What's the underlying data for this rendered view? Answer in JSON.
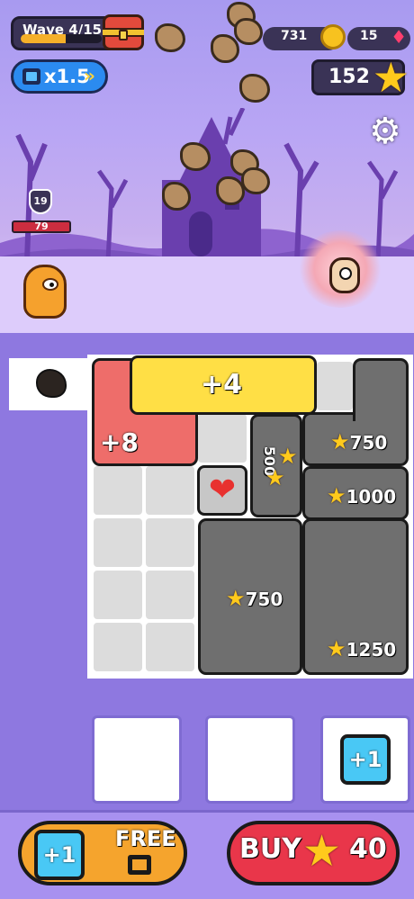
{
  "hud": {
    "wave_label": "Wave 4/15",
    "wave_progress": 0.55,
    "coins": "731",
    "gems": "15",
    "speed": "x1.5",
    "stars": "152"
  },
  "enemy": {
    "level": "19",
    "hp": "79"
  },
  "board": {
    "next_piece": "rock",
    "blocks": {
      "plus4": "+4",
      "plus8": "+8",
      "b750_top": "750",
      "b_vertical": "500",
      "b1000": "1000",
      "b750_big": "750",
      "b1250": "1250"
    }
  },
  "slots": {
    "plus1": "+1"
  },
  "footer": {
    "free_plus": "+1",
    "free_label": "FREE",
    "buy_label": "BUY",
    "buy_price": "40"
  },
  "colors": {
    "accent_yellow": "#ffdf45",
    "block_red": "#ee6d6a",
    "block_dark": "#6f6f6f",
    "button_orange": "#f5a42d",
    "button_red": "#e9364a",
    "button_blue": "#49c8f5"
  }
}
